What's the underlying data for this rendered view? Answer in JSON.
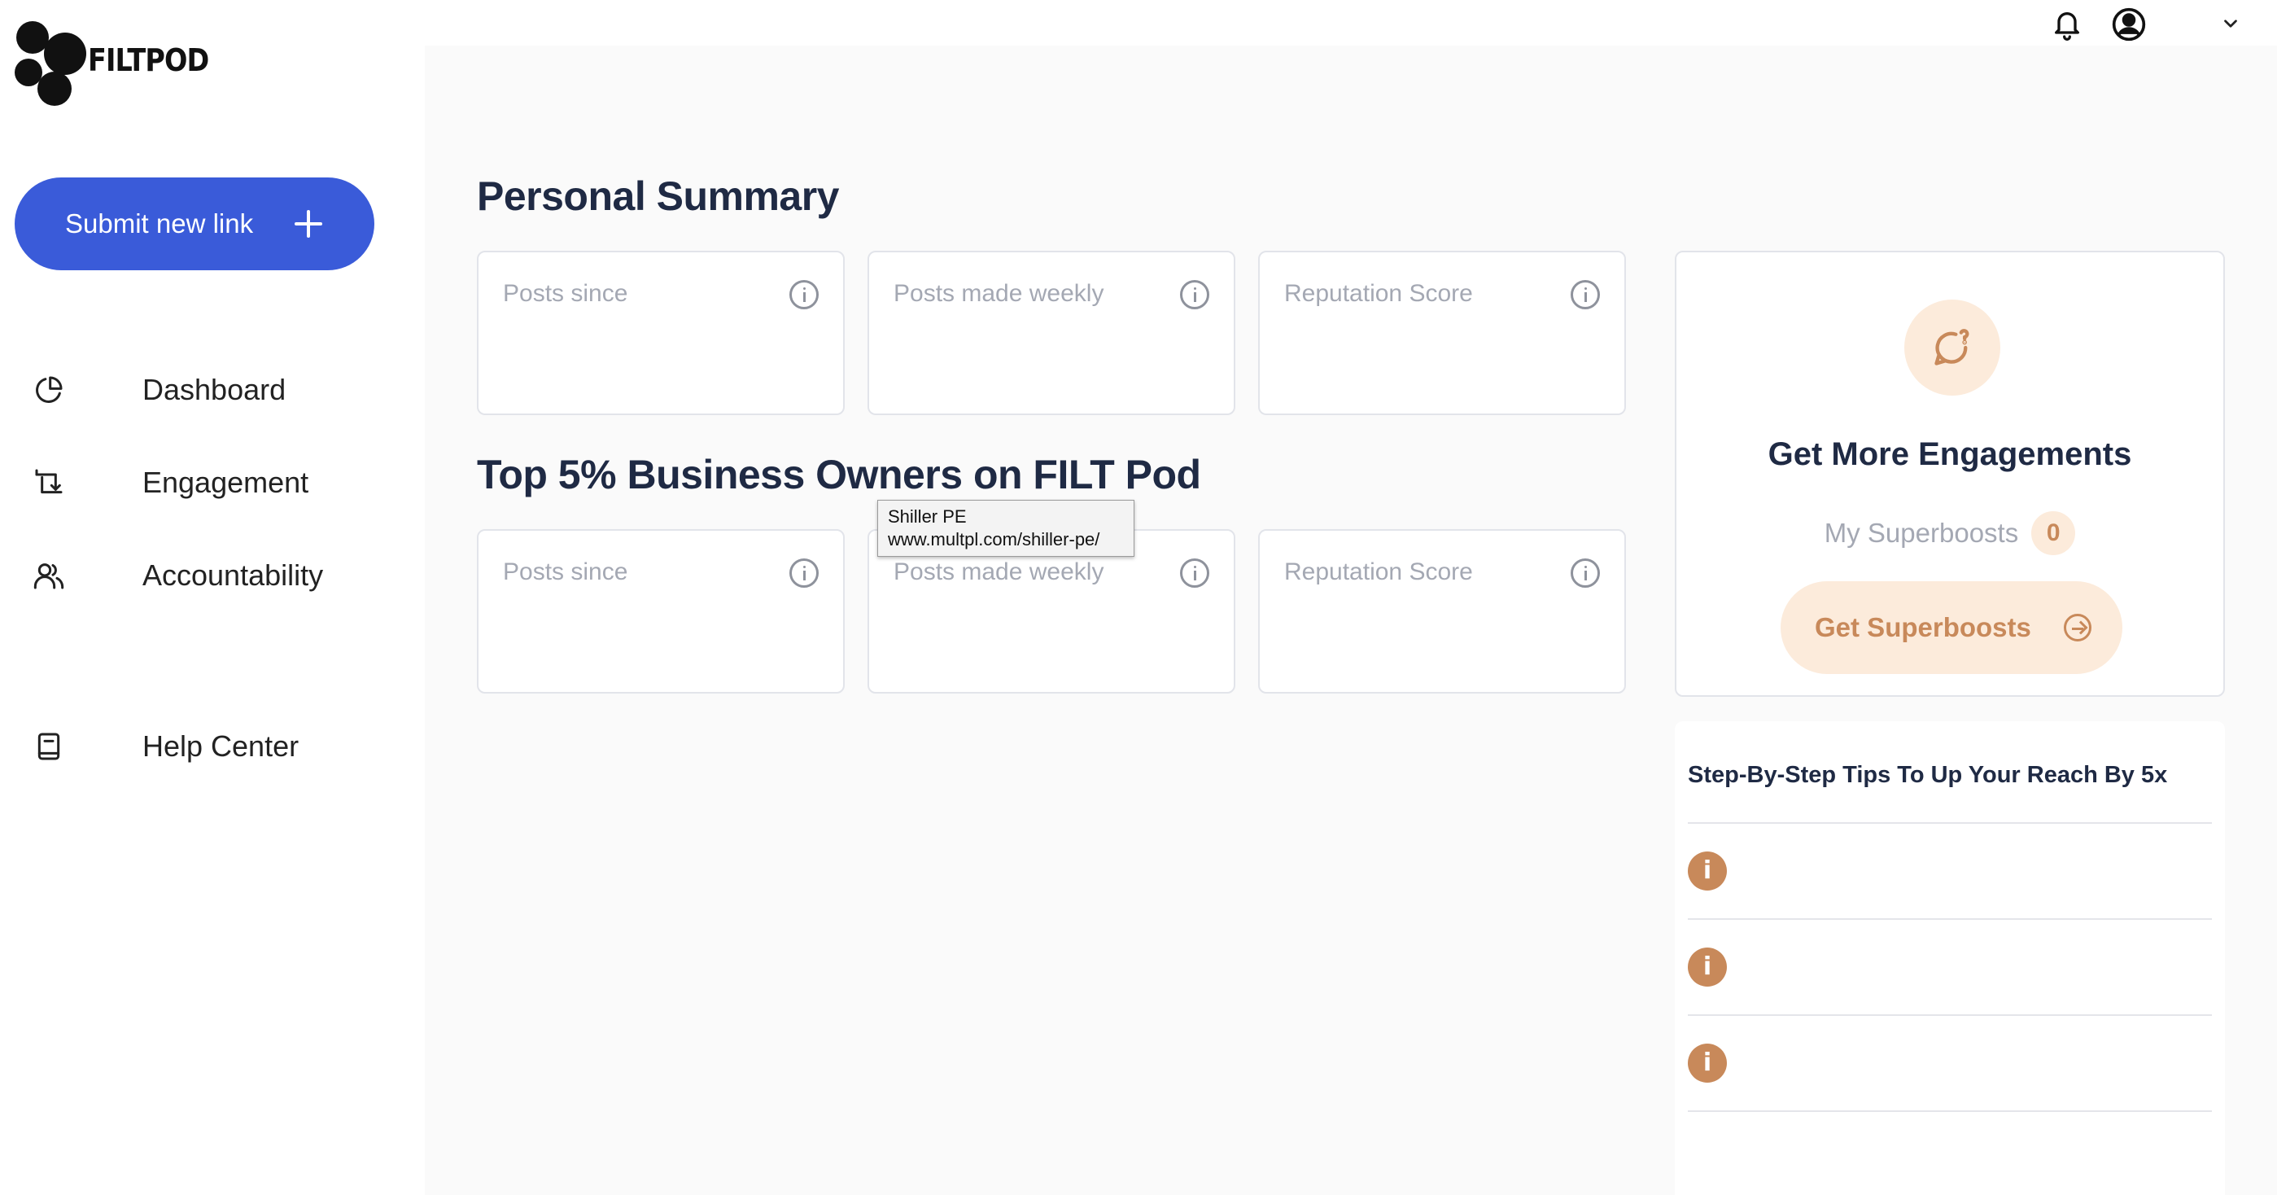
{
  "brand": {
    "name": "FILTPOD"
  },
  "sidebar": {
    "submit_button": "Submit new link",
    "items": [
      {
        "label": "Dashboard",
        "icon": "pie-chart-icon"
      },
      {
        "label": "Engagement",
        "icon": "repeat-icon"
      },
      {
        "label": "Accountability",
        "icon": "users-icon"
      },
      {
        "label": "Help Center",
        "icon": "book-icon"
      }
    ]
  },
  "topbar": {
    "icons": [
      "bell-icon",
      "user-circle-icon",
      "chevron-down-icon"
    ]
  },
  "personal_summary": {
    "title": "Personal Summary",
    "cards": [
      {
        "label": "Posts since"
      },
      {
        "label": "Posts made weekly"
      },
      {
        "label": "Reputation Score"
      }
    ]
  },
  "top_owners": {
    "title": "Top 5% Business Owners on FILT Pod",
    "cards": [
      {
        "label": "Posts since"
      },
      {
        "label": "Posts made weekly"
      },
      {
        "label": "Reputation Score"
      }
    ]
  },
  "tooltip": {
    "line1": "Shiller PE",
    "line2": "www.multpl.com/shiller-pe/"
  },
  "engagements": {
    "title": "Get More Engagements",
    "superboosts_label": "My Superboosts",
    "superboosts_count": "0",
    "button": "Get Superboosts"
  },
  "tips": {
    "title": "Step-By-Step Tips To Up Your Reach By 5x",
    "items": [
      {
        "icon": "i"
      },
      {
        "icon": "i"
      },
      {
        "icon": "i"
      }
    ]
  },
  "colors": {
    "primary": "#3a5bd9",
    "accent": "#c8895a",
    "accent_bg": "#fcebdb",
    "heading": "#1f2a44",
    "muted": "#a4a8b3"
  }
}
